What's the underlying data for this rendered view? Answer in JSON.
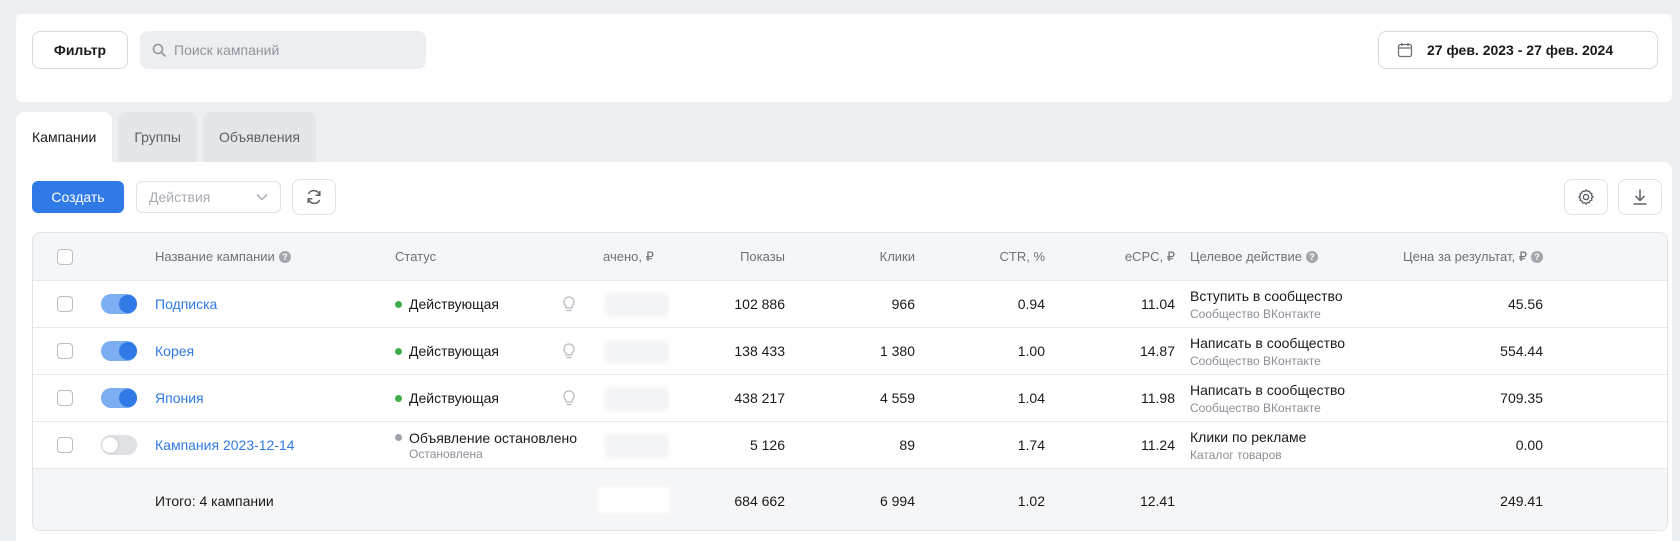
{
  "topbar": {
    "filter_label": "Фильтр",
    "search_placeholder": "Поиск кампаний",
    "date_range": "27 фев. 2023 - 27 фев. 2024"
  },
  "tabs": [
    {
      "label": "Кампании",
      "active": true
    },
    {
      "label": "Группы",
      "active": false
    },
    {
      "label": "Объявления",
      "active": false
    }
  ],
  "toolbar": {
    "create_label": "Создать",
    "actions_placeholder": "Действия"
  },
  "table": {
    "columns": {
      "name": "Название кампании",
      "status": "Статус",
      "spent": "ачено, ₽",
      "impressions": "Показы",
      "clicks": "Клики",
      "ctr": "CTR, %",
      "ecpc": "eCPC, ₽",
      "goal": "Целевое действие",
      "cpr": "Цена за результат, ₽"
    },
    "rows": [
      {
        "enabled": true,
        "name": "Подписка",
        "status": "Действующая",
        "status_sub": "",
        "status_color": "#3fae49",
        "impressions": "102 886",
        "clicks": "966",
        "ctr": "0.94",
        "ecpc": "11.04",
        "goal": "Вступить в сообщество",
        "goal_sub": "Сообщество ВКонтакте",
        "cpr": "45.56"
      },
      {
        "enabled": true,
        "name": "Корея",
        "status": "Действующая",
        "status_sub": "",
        "status_color": "#3fae49",
        "impressions": "138 433",
        "clicks": "1 380",
        "ctr": "1.00",
        "ecpc": "14.87",
        "goal": "Написать в сообщество",
        "goal_sub": "Сообщество ВКонтакте",
        "cpr": "554.44"
      },
      {
        "enabled": true,
        "name": "Япония",
        "status": "Действующая",
        "status_sub": "",
        "status_color": "#3fae49",
        "impressions": "438 217",
        "clicks": "4 559",
        "ctr": "1.04",
        "ecpc": "11.98",
        "goal": "Написать в сообщество",
        "goal_sub": "Сообщество ВКонтакте",
        "cpr": "709.35"
      },
      {
        "enabled": false,
        "name": "Кампания 2023-12-14",
        "status": "Объявление остановлено",
        "status_sub": "Остановлена",
        "status_color": "#9ea3aa",
        "impressions": "5 126",
        "clicks": "89",
        "ctr": "1.74",
        "ecpc": "11.24",
        "goal": "Клики по рекламе",
        "goal_sub": "Каталог товаров",
        "cpr": "0.00"
      }
    ],
    "total": {
      "label": "Итого: 4 кампании",
      "impressions": "684 662",
      "clicks": "6 994",
      "ctr": "1.02",
      "ecpc": "12.41",
      "cpr": "249.41"
    }
  },
  "colors": {
    "accent": "#2f7ae6",
    "active_status": "#3fae49",
    "stopped_status": "#9ea3aa"
  }
}
